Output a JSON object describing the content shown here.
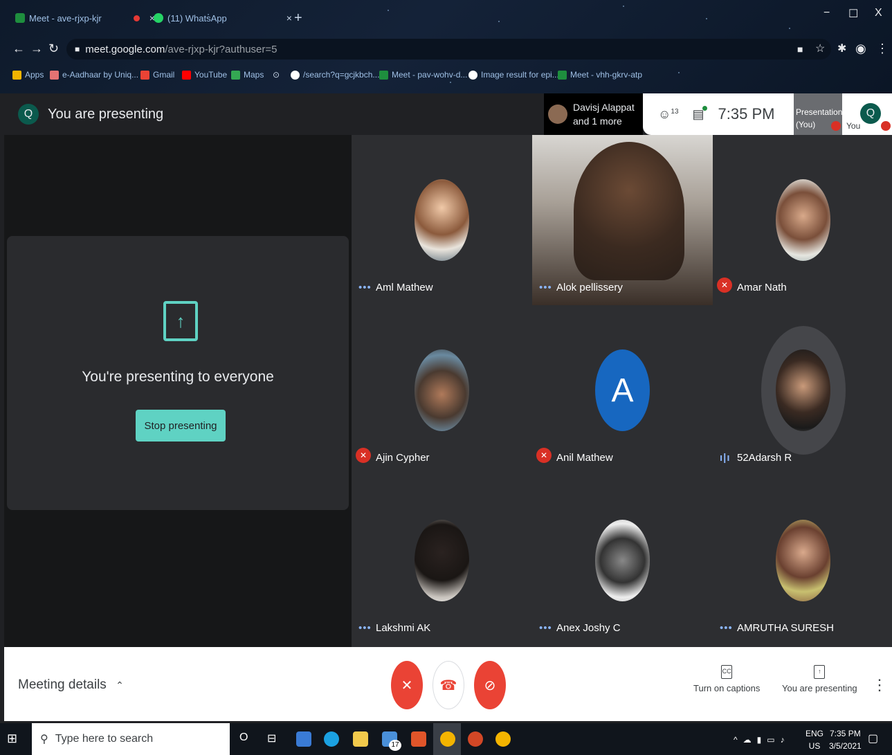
{
  "browser": {
    "tabs": [
      {
        "title": "Meet - ave-rjxp-kjr",
        "favicon_color": "#1e8e3e"
      },
      {
        "title": "(11) WhatsApp",
        "favicon_color": "#25d366"
      }
    ],
    "new_tab": "+",
    "window_controls": {
      "minimize": "−",
      "maximize": "☐",
      "close": "X"
    },
    "address": {
      "host": "meet.google.com",
      "path": "/ave-rjxp-kjr?authuser=5"
    },
    "bookmarks": [
      "Apps",
      "e-Aadhaar by Uniq...",
      "Gmail",
      "YouTube",
      "Maps",
      "/search?q=gcjkbch...",
      "Meet - pav-wohv-d...",
      "Image result for epi...",
      "Meet - vhh-gkrv-atp"
    ]
  },
  "header": {
    "avatar_letter": "Q",
    "presenting_title": "You are presenting",
    "active_speaker": {
      "line1": "Davisj Alappat",
      "line2": "and 1 more"
    },
    "participant_count": "13",
    "time": "7:35 PM",
    "presentation_tile": {
      "line1": "Presentation",
      "line2": "(You)"
    },
    "you_tile": {
      "letter": "Q",
      "label": "You"
    }
  },
  "presenting_card": {
    "message": "You're presenting to everyone",
    "stop_button": "Stop presenting"
  },
  "participants": [
    {
      "name": "Aml Mathew",
      "status": "dots"
    },
    {
      "name": "Alok pellissery",
      "status": "dots"
    },
    {
      "name": "Amar Nath",
      "status": "muted"
    },
    {
      "name": "Ajin Cypher",
      "status": "muted"
    },
    {
      "name": "Anil Mathew",
      "status": "muted",
      "letter": "A"
    },
    {
      "name": "52Adarsh R",
      "status": "speaking"
    },
    {
      "name": "Lakshmi AK",
      "status": "dots"
    },
    {
      "name": "Anex Joshy C",
      "status": "dots"
    },
    {
      "name": "AMRUTHA SURESH",
      "status": "dots"
    }
  ],
  "controls": {
    "meeting_details": "Meeting details",
    "captions_label": "Turn on captions",
    "presenting_label": "You are presenting",
    "captions_icon": "CC"
  },
  "taskbar": {
    "search_placeholder": "Type here to search",
    "badge_count": "17",
    "lang": {
      "line1": "ENG",
      "line2": "US"
    },
    "clock": {
      "time": "7:35 PM",
      "date": "3/5/2021"
    }
  }
}
